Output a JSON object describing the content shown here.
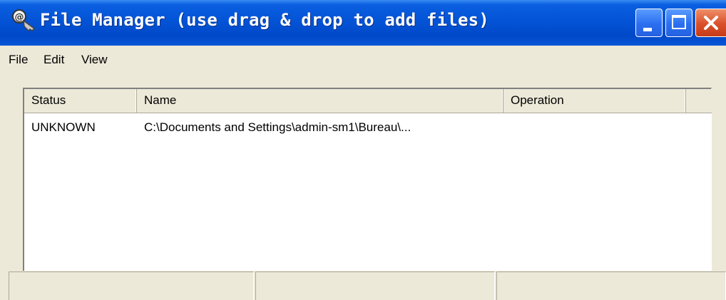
{
  "window": {
    "title": "File Manager (use drag & drop to add files)",
    "icon": "key-magnifier-icon"
  },
  "controls": {
    "minimize_icon": "minimize-icon",
    "maximize_icon": "maximize-icon",
    "close_icon": "close-icon"
  },
  "menu": {
    "items": [
      {
        "label": "File"
      },
      {
        "label": "Edit"
      },
      {
        "label": "View"
      }
    ]
  },
  "table": {
    "columns": [
      "Status",
      "Name",
      "Operation",
      ""
    ],
    "rows": [
      {
        "status": "UNKNOWN",
        "name": "C:\\Documents and Settings\\admin-sm1\\Bureau\\...",
        "operation": ""
      }
    ]
  },
  "statusbar": {
    "panels": [
      "",
      "",
      ""
    ]
  },
  "colors": {
    "titlebar": "#0453d6",
    "window_bg": "#ece9d8",
    "close_button": "#d9502a"
  }
}
